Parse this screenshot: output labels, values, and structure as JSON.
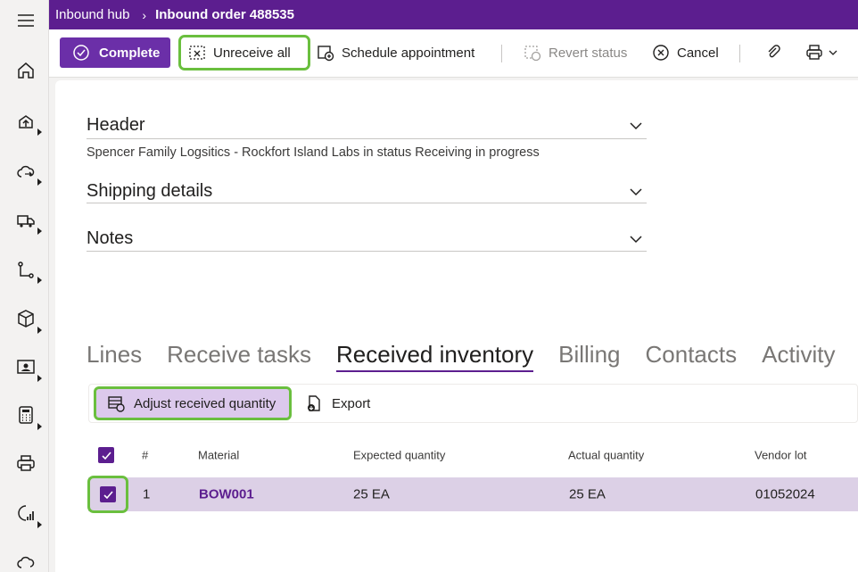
{
  "breadcrumb": {
    "parent": "Inbound hub",
    "current": "Inbound order 488535"
  },
  "toolbar": {
    "complete": "Complete",
    "unreceive_all": "Unreceive all",
    "schedule": "Schedule appointment",
    "revert": "Revert status",
    "cancel": "Cancel"
  },
  "sections": {
    "header": "Header",
    "header_desc": "Spencer Family Logsitics - Rockfort Island Labs in status Receiving in progress",
    "shipping": "Shipping details",
    "notes": "Notes"
  },
  "tabs": [
    "Lines",
    "Receive tasks",
    "Received inventory",
    "Billing",
    "Contacts",
    "Activity"
  ],
  "grid_toolbar": {
    "adjust": "Adjust received quantity",
    "export": "Export"
  },
  "table": {
    "columns": [
      "#",
      "Material",
      "Expected quantity",
      "Actual quantity",
      "Vendor lot"
    ],
    "rows": [
      {
        "num": "1",
        "material": "BOW001",
        "expected": "25 EA",
        "actual": "25 EA",
        "vendor_lot": "01052024"
      }
    ]
  },
  "colors": {
    "brand": "#5c1e8f",
    "highlight": "#6abf3e",
    "selected_row": "#dcd0e6"
  }
}
